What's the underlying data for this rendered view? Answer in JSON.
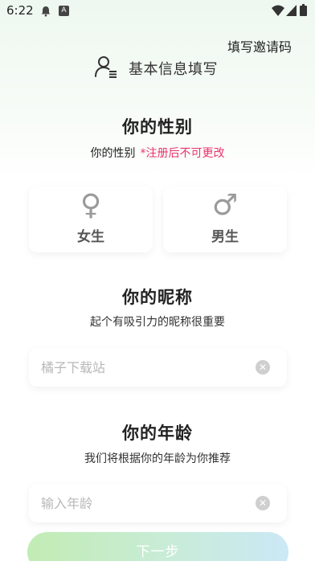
{
  "status_bar": {
    "time": "6:22",
    "badge_letter": "A"
  },
  "top_link": "填写邀请码",
  "header": {
    "title": "基本信息填写",
    "icon": "user-profile-icon"
  },
  "gender": {
    "title": "你的性别",
    "subtitle": "你的性别",
    "note": "*注册后不可更改",
    "options": [
      {
        "symbol": "♀",
        "label": "女生"
      },
      {
        "symbol": "♂",
        "label": "男生"
      }
    ]
  },
  "nickname": {
    "title": "你的昵称",
    "subtitle": "起个有吸引力的昵称很重要",
    "placeholder": "橘子下载站",
    "value": ""
  },
  "age": {
    "title": "你的年龄",
    "subtitle": "我们将根据你的年龄为你推荐",
    "placeholder": "输入年龄",
    "value": ""
  },
  "next_button": "下一步",
  "colors": {
    "accent_note": "#e8336d",
    "button_gradient": [
      "#c2ecb4",
      "#cbe8f6"
    ]
  }
}
